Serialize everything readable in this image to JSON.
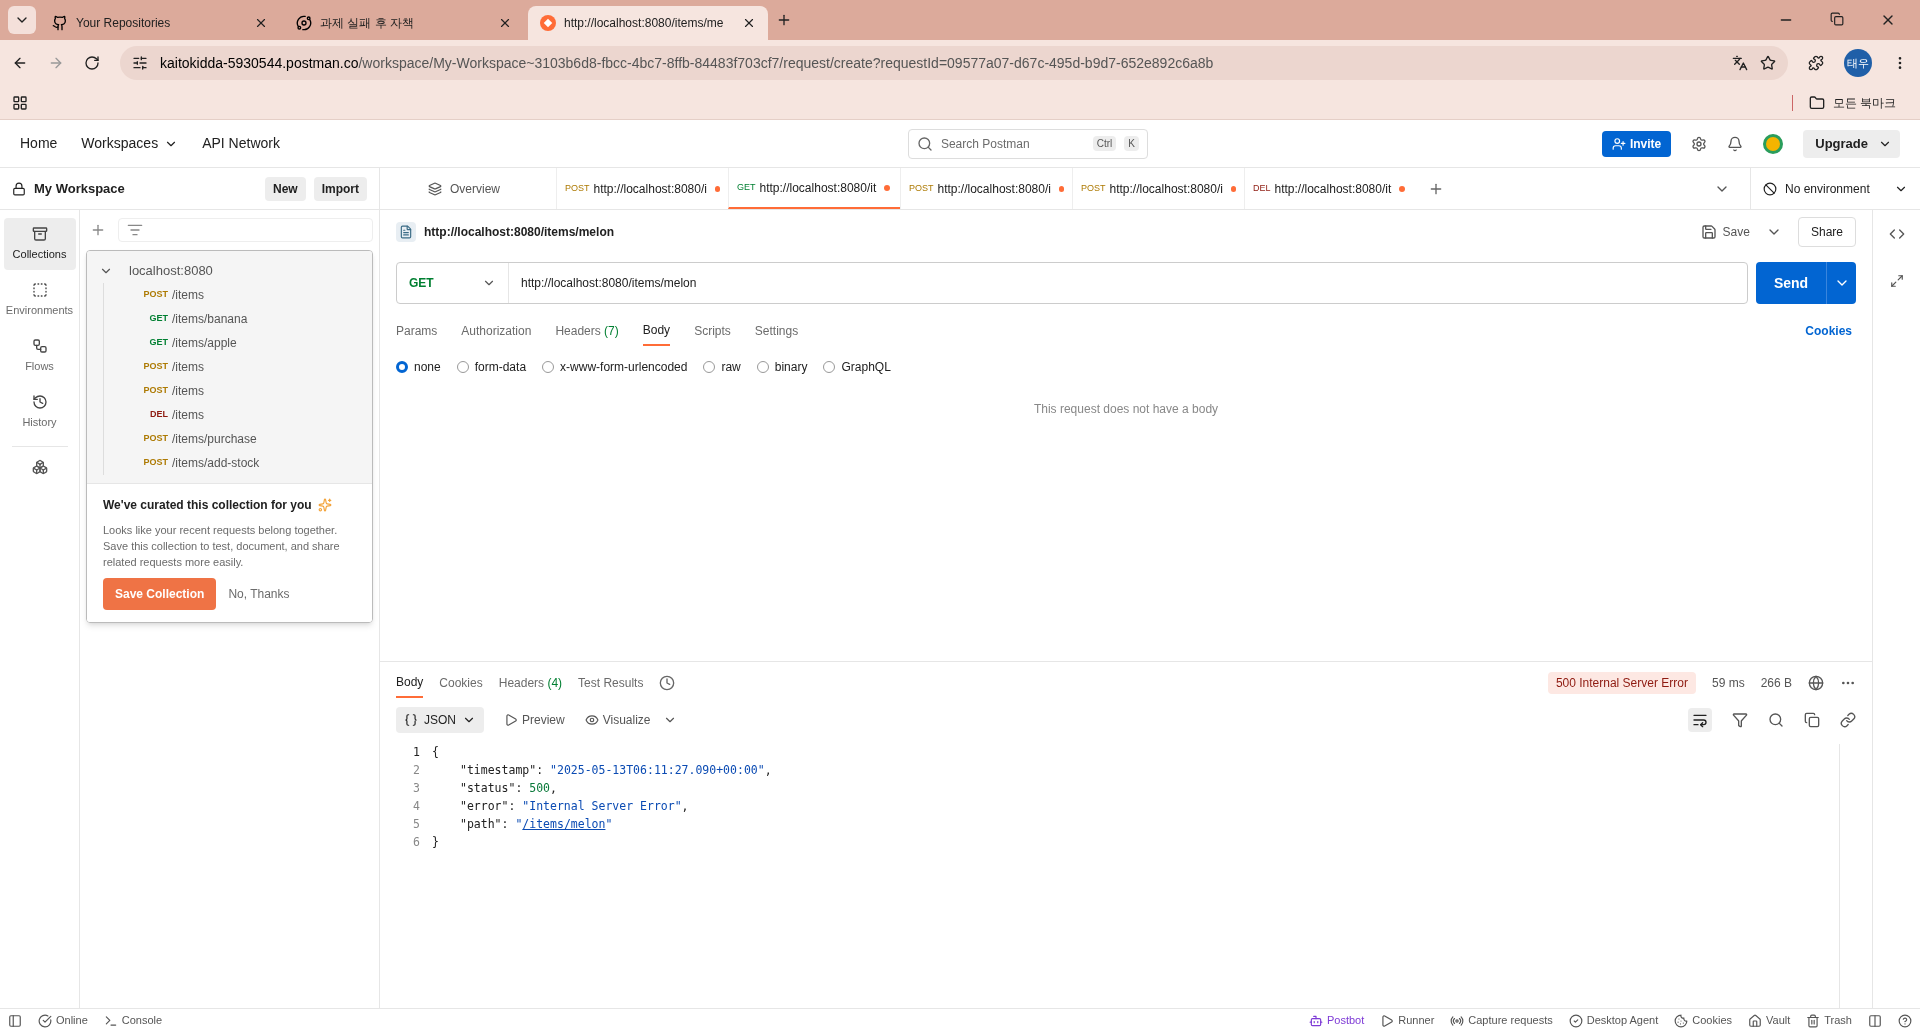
{
  "browser": {
    "tabs": [
      {
        "kind": "github",
        "title": "Your Repositories",
        "selected": false
      },
      {
        "kind": "openai",
        "title": "과제 실패 후 자책",
        "selected": false
      },
      {
        "kind": "postman",
        "title": "http://localhost:8080/items/me",
        "selected": true
      }
    ],
    "address_host": "kaitokidda-5930544.postman.co",
    "address_path": "/workspace/My-Workspace~3103b6d8-fbcc-4bc7-8ffb-84483f703cf7/request/create?requestId=09577a07-d67c-495d-b9d7-652e892c6a8b",
    "profile": "태우",
    "bookmarks": "모든 북마크"
  },
  "header": {
    "nav": [
      "Home",
      "Workspaces",
      "API Network"
    ],
    "search_placeholder": "Search Postman",
    "shortcut": [
      "Ctrl",
      "K"
    ],
    "invite": "Invite",
    "upgrade": "Upgrade"
  },
  "workspace": {
    "name": "My Workspace",
    "buttons": [
      "New",
      "Import"
    ]
  },
  "rail": [
    {
      "kind": "collections",
      "label": "Collections",
      "selected": true
    },
    {
      "kind": "environments",
      "label": "Environments",
      "selected": false
    },
    {
      "kind": "flows",
      "label": "Flows",
      "selected": false
    },
    {
      "kind": "history",
      "label": "History",
      "selected": false
    }
  ],
  "collection": {
    "name": "localhost:8080",
    "expanded": true,
    "requests": [
      {
        "method": "POST",
        "path": "/items"
      },
      {
        "method": "GET",
        "path": "/items/banana"
      },
      {
        "method": "GET",
        "path": "/items/apple"
      },
      {
        "method": "POST",
        "path": "/items"
      },
      {
        "method": "POST",
        "path": "/items"
      },
      {
        "method": "DEL",
        "path": "/items"
      },
      {
        "method": "POST",
        "path": "/items/purchase"
      },
      {
        "method": "POST",
        "path": "/items/add-stock"
      }
    ]
  },
  "curate": {
    "title": "We've curated this collection for you",
    "text": "Looks like your recent requests belong together. Save this collection to test, document, and share related requests more easily.",
    "primary": "Save Collection",
    "secondary": "No, Thanks"
  },
  "request_tabs": {
    "overview": "Overview",
    "tabs": [
      {
        "method": "POST",
        "url": "http://localhost:8080/i",
        "selected": false,
        "unsaved": true
      },
      {
        "method": "GET",
        "url": "http://localhost:8080/it",
        "selected": true,
        "unsaved": true
      },
      {
        "method": "POST",
        "url": "http://localhost:8080/i",
        "selected": false,
        "unsaved": true
      },
      {
        "method": "POST",
        "url": "http://localhost:8080/i",
        "selected": false,
        "unsaved": true
      },
      {
        "method": "DEL",
        "url": "http://localhost:8080/it",
        "selected": false,
        "unsaved": true
      }
    ],
    "environment": "No environment"
  },
  "request": {
    "title": "http://localhost:8080/items/melon",
    "save": "Save",
    "share": "Share",
    "method": "GET",
    "url": "http://localhost:8080/items/melon",
    "send": "Send",
    "tabs": [
      {
        "label": "Params",
        "selected": false
      },
      {
        "label": "Authorization",
        "selected": false
      },
      {
        "label": "Headers",
        "count": "(7)",
        "selected": false
      },
      {
        "label": "Body",
        "selected": true
      },
      {
        "label": "Scripts",
        "selected": false
      },
      {
        "label": "Settings",
        "selected": false
      }
    ],
    "cookies": "Cookies",
    "body_types": [
      {
        "label": "none",
        "selected": true
      },
      {
        "label": "form-data",
        "selected": false
      },
      {
        "label": "x-www-form-urlencoded",
        "selected": false
      },
      {
        "label": "raw",
        "selected": false
      },
      {
        "label": "binary",
        "selected": false
      },
      {
        "label": "GraphQL",
        "selected": false
      }
    ],
    "empty_message": "This request does not have a body"
  },
  "response": {
    "tabs": [
      {
        "label": "Body",
        "selected": true
      },
      {
        "label": "Cookies",
        "selected": false
      },
      {
        "label": "Headers",
        "count": "(4)",
        "selected": false
      },
      {
        "label": "Test Results",
        "selected": false
      }
    ],
    "status": "500 Internal Server Error",
    "time": "59 ms",
    "size": "266 B",
    "format": "JSON",
    "preview": "Preview",
    "visualize": "Visualize",
    "lines": [
      {
        "number": "1",
        "tokens": [
          {
            "kind": "punct",
            "text": "{"
          }
        ]
      },
      {
        "number": "2",
        "tokens": [
          {
            "kind": "key",
            "text": "\"timestamp\""
          },
          {
            "kind": "punct",
            "text": ": "
          },
          {
            "kind": "string",
            "text": "\"2025-05-13T06:11:27.090+00:00\""
          },
          {
            "kind": "punct",
            "text": ","
          }
        ]
      },
      {
        "number": "3",
        "tokens": [
          {
            "kind": "key",
            "text": "\"status\""
          },
          {
            "kind": "punct",
            "text": ": "
          },
          {
            "kind": "number",
            "text": "500"
          },
          {
            "kind": "punct",
            "text": ","
          }
        ]
      },
      {
        "number": "4",
        "tokens": [
          {
            "kind": "key",
            "text": "\"error\""
          },
          {
            "kind": "punct",
            "text": ": "
          },
          {
            "kind": "string",
            "text": "\"Internal Server Error\""
          },
          {
            "kind": "punct",
            "text": ","
          }
        ]
      },
      {
        "number": "5",
        "tokens": [
          {
            "kind": "key",
            "text": "\"path\""
          },
          {
            "kind": "punct",
            "text": ": "
          },
          {
            "kind": "string",
            "text": "\""
          },
          {
            "kind": "link",
            "text": "/items/melon"
          },
          {
            "kind": "string",
            "text": "\""
          }
        ]
      },
      {
        "number": "6",
        "tokens": [
          {
            "kind": "punct",
            "text": "}"
          }
        ]
      }
    ]
  },
  "status_bar": {
    "left": [
      {
        "kind": "online",
        "label": "Online"
      },
      {
        "kind": "console",
        "label": "Console"
      }
    ],
    "right": [
      {
        "kind": "postbot",
        "label": "Postbot"
      },
      {
        "kind": "runner",
        "label": "Runner"
      },
      {
        "kind": "capture",
        "label": "Capture requests"
      },
      {
        "kind": "agent",
        "label": "Desktop Agent"
      },
      {
        "kind": "cookies",
        "label": "Cookies"
      },
      {
        "kind": "vault",
        "label": "Vault"
      },
      {
        "kind": "trash",
        "label": "Trash"
      }
    ]
  }
}
